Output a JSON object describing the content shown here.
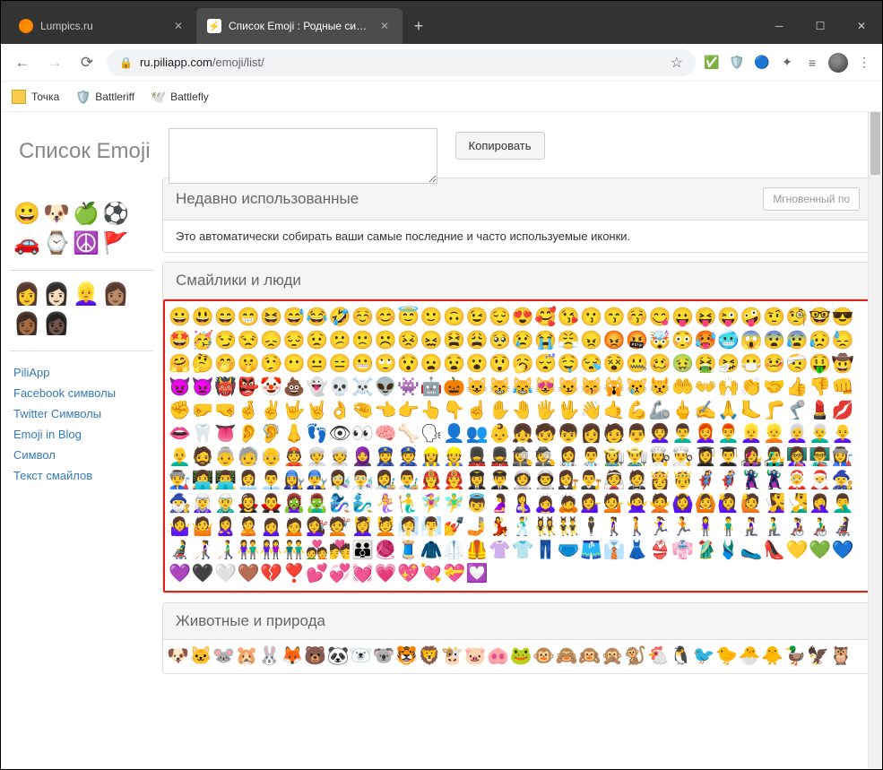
{
  "window": {
    "tabs": [
      {
        "title": "Lumpics.ru",
        "active": false
      },
      {
        "title": "Список Emoji : Родные символь",
        "active": true
      }
    ]
  },
  "addressbar": {
    "host": "ru.piliapp.com",
    "path": "/emoji/list/"
  },
  "bookmarks": [
    {
      "label": "Точка"
    },
    {
      "label": "Battleriff"
    },
    {
      "label": "Battlefly"
    }
  ],
  "page": {
    "title": "Список Emoji",
    "copy_button": "Копировать",
    "instant_button": "Мгновенный по",
    "sections": {
      "recent": {
        "title": "Недавно использованные",
        "description": "Это автоматически собирать ваши самые последние и часто используемые иконки."
      },
      "smileys": {
        "title": "Смайлики и люди"
      },
      "animals": {
        "title": "Животные и природа"
      }
    }
  },
  "sidebar": {
    "example_emoji_1": [
      "😀",
      "🐶",
      "🍏",
      "⚽",
      "🚗",
      "⌚",
      "☮️",
      "🚩"
    ],
    "example_emoji_2": [
      "👩",
      "👩🏻",
      "👱‍♀️",
      "👩🏽",
      "👩🏾",
      "👩🏿"
    ],
    "links": [
      "PiliApp",
      "Facebook символы",
      "Twitter Символы",
      "Emoji in Blog",
      "Символ",
      "Текст смайлов"
    ]
  },
  "emoji_data": {
    "smileys": [
      "😀",
      "😃",
      "😄",
      "😁",
      "😆",
      "😅",
      "😂",
      "🤣",
      "☺️",
      "😊",
      "😇",
      "🙂",
      "🙃",
      "😉",
      "😌",
      "😍",
      "🥰",
      "😘",
      "😗",
      "😙",
      "😚",
      "😋",
      "😛",
      "😝",
      "😜",
      "🤪",
      "🤨",
      "🧐",
      "🤓",
      "😎",
      "🤩",
      "🥳",
      "😏",
      "😒",
      "😞",
      "😔",
      "😟",
      "😕",
      "🙁",
      "☹️",
      "😣",
      "😖",
      "😫",
      "😩",
      "🥺",
      "😢",
      "😭",
      "😤",
      "😠",
      "😡",
      "🤬",
      "🤯",
      "😳",
      "🥵",
      "🥶",
      "😱",
      "😨",
      "😰",
      "😥",
      "😓",
      "🤗",
      "🤔",
      "🤭",
      "🤫",
      "🤥",
      "😶",
      "😐",
      "😑",
      "😬",
      "🙄",
      "😯",
      "😦",
      "😧",
      "😮",
      "😲",
      "🥱",
      "😴",
      "🤤",
      "😪",
      "😵",
      "🤐",
      "🥴",
      "🤢",
      "🤮",
      "🤧",
      "😷",
      "🤒",
      "🤕",
      "🤑",
      "🤠",
      "😈",
      "👿",
      "👹",
      "👺",
      "🤡",
      "💩",
      "👻",
      "💀",
      "☠️",
      "👽",
      "👾",
      "🤖",
      "🎃",
      "😺",
      "😸",
      "😹",
      "😻",
      "😼",
      "😽",
      "🙀",
      "😿",
      "😾",
      "🤲",
      "👐",
      "🙌",
      "👏",
      "🤝",
      "👍",
      "👎",
      "👊",
      "✊",
      "🤛",
      "🤜",
      "🤞",
      "✌️",
      "🤟",
      "🤘",
      "👌",
      "🤏",
      "👈",
      "👉",
      "👆",
      "👇",
      "☝️",
      "✋",
      "🤚",
      "🖐",
      "🖖",
      "👋",
      "🤙",
      "💪",
      "🦾",
      "🖕",
      "✍️",
      "🙏",
      "🦶",
      "🦵",
      "🦿",
      "💄",
      "💋",
      "👄",
      "🦷",
      "👅",
      "👂",
      "🦻",
      "👃",
      "👣",
      "👁",
      "👀",
      "🧠",
      "🦴",
      "🗣",
      "👤",
      "👥",
      "👶",
      "👧",
      "🧒",
      "👦",
      "👩",
      "🧑",
      "👨",
      "👩‍🦱",
      "👨‍🦱",
      "👩‍🦰",
      "👨‍🦰",
      "👱‍♀️",
      "👱",
      "👩‍🦳",
      "👨‍🦳",
      "👩‍🦲",
      "👨‍🦲",
      "🧔",
      "👵",
      "🧓",
      "👴",
      "👲",
      "👳‍♀️",
      "👳",
      "🧕",
      "👮‍♀️",
      "👮",
      "👷‍♀️",
      "👷",
      "💂‍♀️",
      "💂",
      "🕵️‍♀️",
      "🕵️",
      "👩‍⚕️",
      "👨‍⚕️",
      "👩‍🌾",
      "👨‍🌾",
      "👩‍🍳",
      "👨‍🍳",
      "👩‍🎓",
      "👨‍🎓",
      "👩‍🎤",
      "👨‍🎤",
      "👩‍🏫",
      "👨‍🏫",
      "👩‍🏭",
      "👨‍🏭",
      "👩‍💻",
      "👨‍💻",
      "👩‍💼",
      "👨‍💼",
      "👩‍🔧",
      "👨‍🔧",
      "👩‍🔬",
      "👨‍🔬",
      "👩‍🎨",
      "👨‍🎨",
      "👩‍🚒",
      "👨‍🚒",
      "👩‍✈️",
      "👨‍✈️",
      "👩‍🚀",
      "👨‍🚀",
      "👩‍⚖️",
      "👨‍⚖️",
      "👰",
      "🤵",
      "👸",
      "🤴",
      "🦸‍♀️",
      "🦸‍♂️",
      "🦹‍♀️",
      "🦹‍♂️",
      "🤶",
      "🎅",
      "🧙‍♀️",
      "🧙‍♂️",
      "🧝‍♀️",
      "🧝‍♂️",
      "🧛‍♀️",
      "🧛‍♂️",
      "🧟‍♀️",
      "🧟‍♂️",
      "🧞‍♀️",
      "🧞‍♂️",
      "🧜‍♀️",
      "🧜‍♂️",
      "🧚‍♀️",
      "🧚‍♂️",
      "👼",
      "🤰",
      "🤱",
      "🙇‍♀️",
      "🙇",
      "💁‍♀️",
      "💁",
      "🙅‍♀️",
      "🙅",
      "🙆‍♀️",
      "🙆",
      "🙋‍♀️",
      "🙋",
      "🧏‍♀️",
      "🧏‍♂️",
      "🤦‍♀️",
      "🤦‍♂️",
      "🤷‍♀️",
      "🤷",
      "🙎‍♀️",
      "🙎",
      "🙍‍♀️",
      "🙍",
      "💇‍♀️",
      "💇",
      "💆‍♀️",
      "💆",
      "🧖‍♀️",
      "🧖‍♂️",
      "💅",
      "🤳",
      "💃",
      "🕺",
      "👯‍♀️",
      "👯‍♂️",
      "🕴",
      "🚶‍♀️",
      "🚶",
      "🏃‍♀️",
      "🏃",
      "🧍‍♀️",
      "🧍‍♂️",
      "🧎‍♀️",
      "🧎‍♂️",
      "👩‍🦽",
      "👨‍🦽",
      "👩‍🦼",
      "👨‍🦼",
      "👩‍🦯",
      "👨‍🦯",
      "👫",
      "👭",
      "👬",
      "💑",
      "💏",
      "👪",
      "🧶",
      "🧵",
      "🧥",
      "🥼",
      "🦺",
      "👚",
      "👕",
      "👖",
      "🩲",
      "🩳",
      "👔",
      "👗",
      "👙",
      "👘",
      "🥻",
      "🩱",
      "🥿",
      "👠",
      "💛",
      "💚",
      "💙",
      "💜",
      "🖤",
      "🤍",
      "🤎",
      "💔",
      "❣️",
      "💕",
      "💞",
      "💓",
      "💗",
      "💖",
      "💘",
      "💝",
      "💟"
    ],
    "animals": [
      "🐶",
      "🐱",
      "🐭",
      "🐹",
      "🐰",
      "🦊",
      "🐻",
      "🐼",
      "🐻‍❄️",
      "🐨",
      "🐯",
      "🦁",
      "🐮",
      "🐷",
      "🐽",
      "🐸",
      "🐵",
      "🙈",
      "🙉",
      "🙊",
      "🐒",
      "🐔",
      "🐧",
      "🐦",
      "🐤",
      "🐣",
      "🐥",
      "🦆",
      "🦅",
      "🦉"
    ]
  }
}
